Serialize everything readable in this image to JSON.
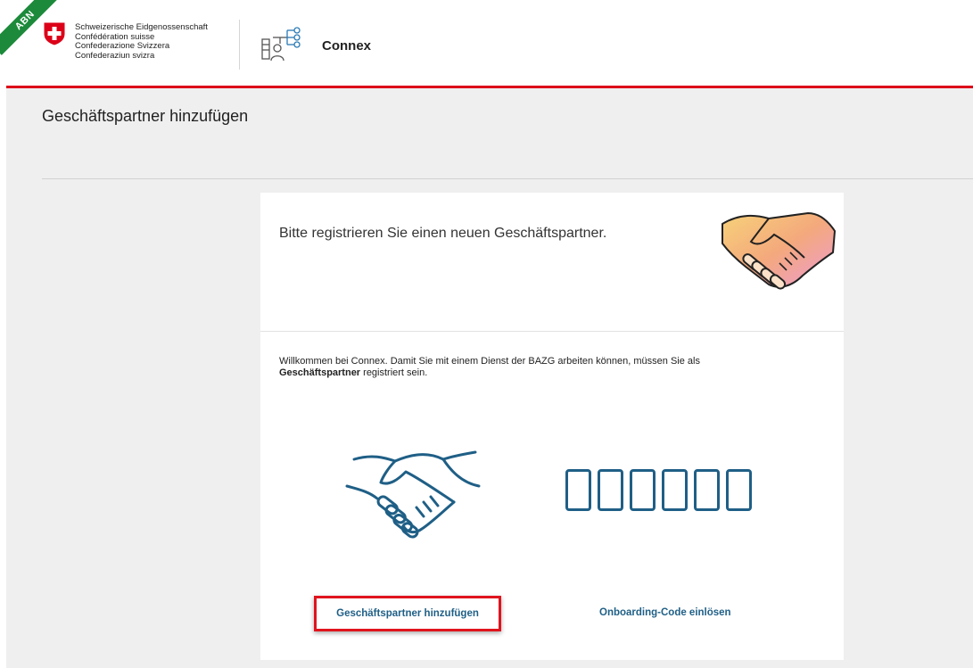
{
  "header": {
    "env_badge": "ABN",
    "federation_names": [
      "Schweizerische Eidgenossenschaft",
      "Confédération suisse",
      "Confederazione Svizzera",
      "Confederaziun svizra"
    ],
    "app_name": "Connex",
    "app_icon": "org-structure-icon",
    "accent_color": "#dc0018"
  },
  "page": {
    "title": "Geschäftspartner hinzufügen"
  },
  "card": {
    "intro": "Bitte registrieren Sie einen neuen Geschäftspartner.",
    "welcome_text": "Willkommen bei Connex. Damit Sie mit einem Dienst der BAZG arbeiten können, müssen Sie als",
    "welcome_bold": "Geschäftspartner",
    "welcome_suffix": " registriert sein.",
    "actions": {
      "add_partner": "Geschäftspartner hinzufügen",
      "redeem_code": "Onboarding-Code einlösen"
    },
    "link_color": "#1f5f86"
  }
}
